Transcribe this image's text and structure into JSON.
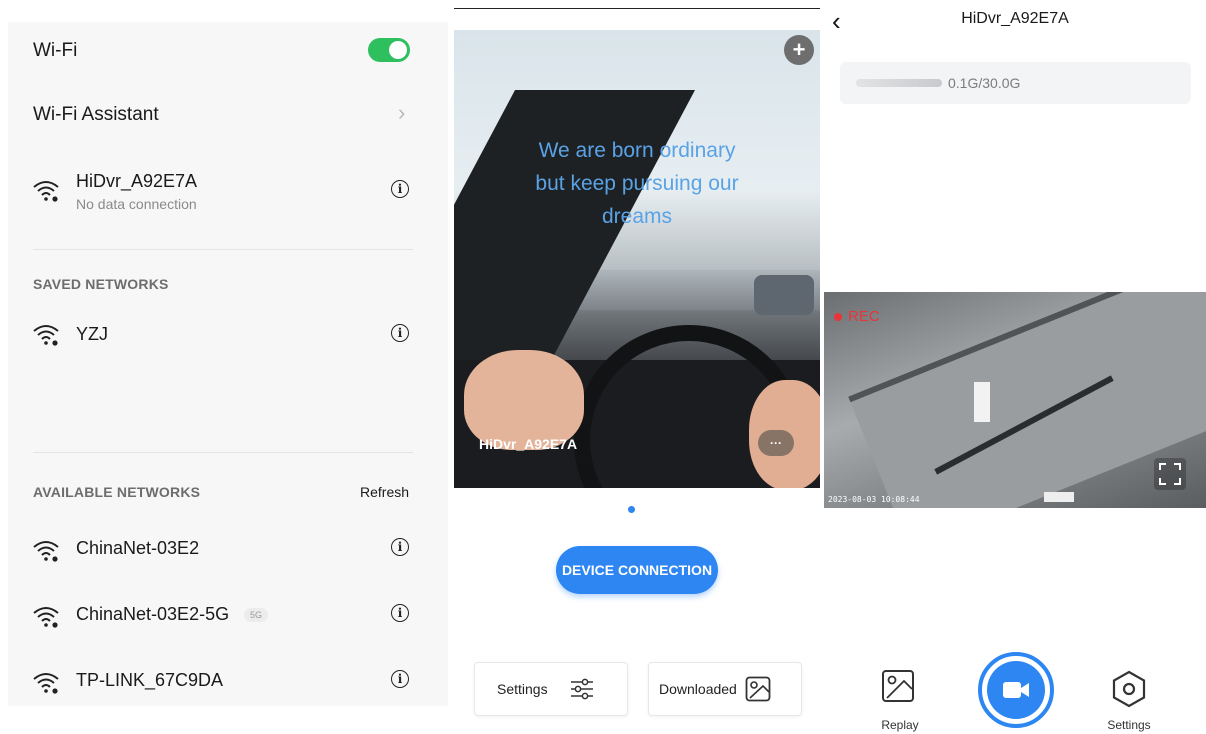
{
  "wifi": {
    "title": "Wi-Fi",
    "toggle_on": true,
    "assistant_label": "Wi-Fi Assistant",
    "connected": {
      "name": "HiDvr_A92E7A",
      "status": "No data connection",
      "icon": "wifi-signal-icon"
    },
    "saved_header": "SAVED NETWORKS",
    "saved": [
      {
        "name": "YZJ",
        "icon": "wifi-signal-icon"
      }
    ],
    "available_header": "AVAILABLE NETWORKS",
    "refresh_label": "Refresh",
    "available": [
      {
        "name": "ChinaNet-03E2",
        "badge": ""
      },
      {
        "name": "ChinaNet-03E2-5G",
        "badge": "5G"
      },
      {
        "name": "TP-LINK_67C9DA",
        "badge": ""
      }
    ],
    "toggle_color": "#2ec05e"
  },
  "device": {
    "banner_text_line1": "We are born ordinary",
    "banner_text_line2": "but keep pursuing our",
    "banner_text_line3": "dreams",
    "device_name": "HiDvr_A92E7A",
    "more_label": "···",
    "add_icon": "plus-icon",
    "connect_button": "DEVICE CONNECTION",
    "settings_label": "Settings",
    "downloaded_label": "Downloaded",
    "accent": "#2d86f2"
  },
  "detail": {
    "title": "HiDvr_A92E7A",
    "storage_text": "0.1G/30.0G",
    "storage_fraction": 0.0033,
    "rec_label": "REC",
    "timestamp": "2023-08-03 10:08:44",
    "tabs": [
      {
        "label": "Replay",
        "icon": "replay-image-icon"
      },
      {
        "label": "",
        "icon": "video-camera-icon"
      },
      {
        "label": "Settings",
        "icon": "hexagon-settings-icon"
      }
    ],
    "rec_color": "#e8353a"
  }
}
